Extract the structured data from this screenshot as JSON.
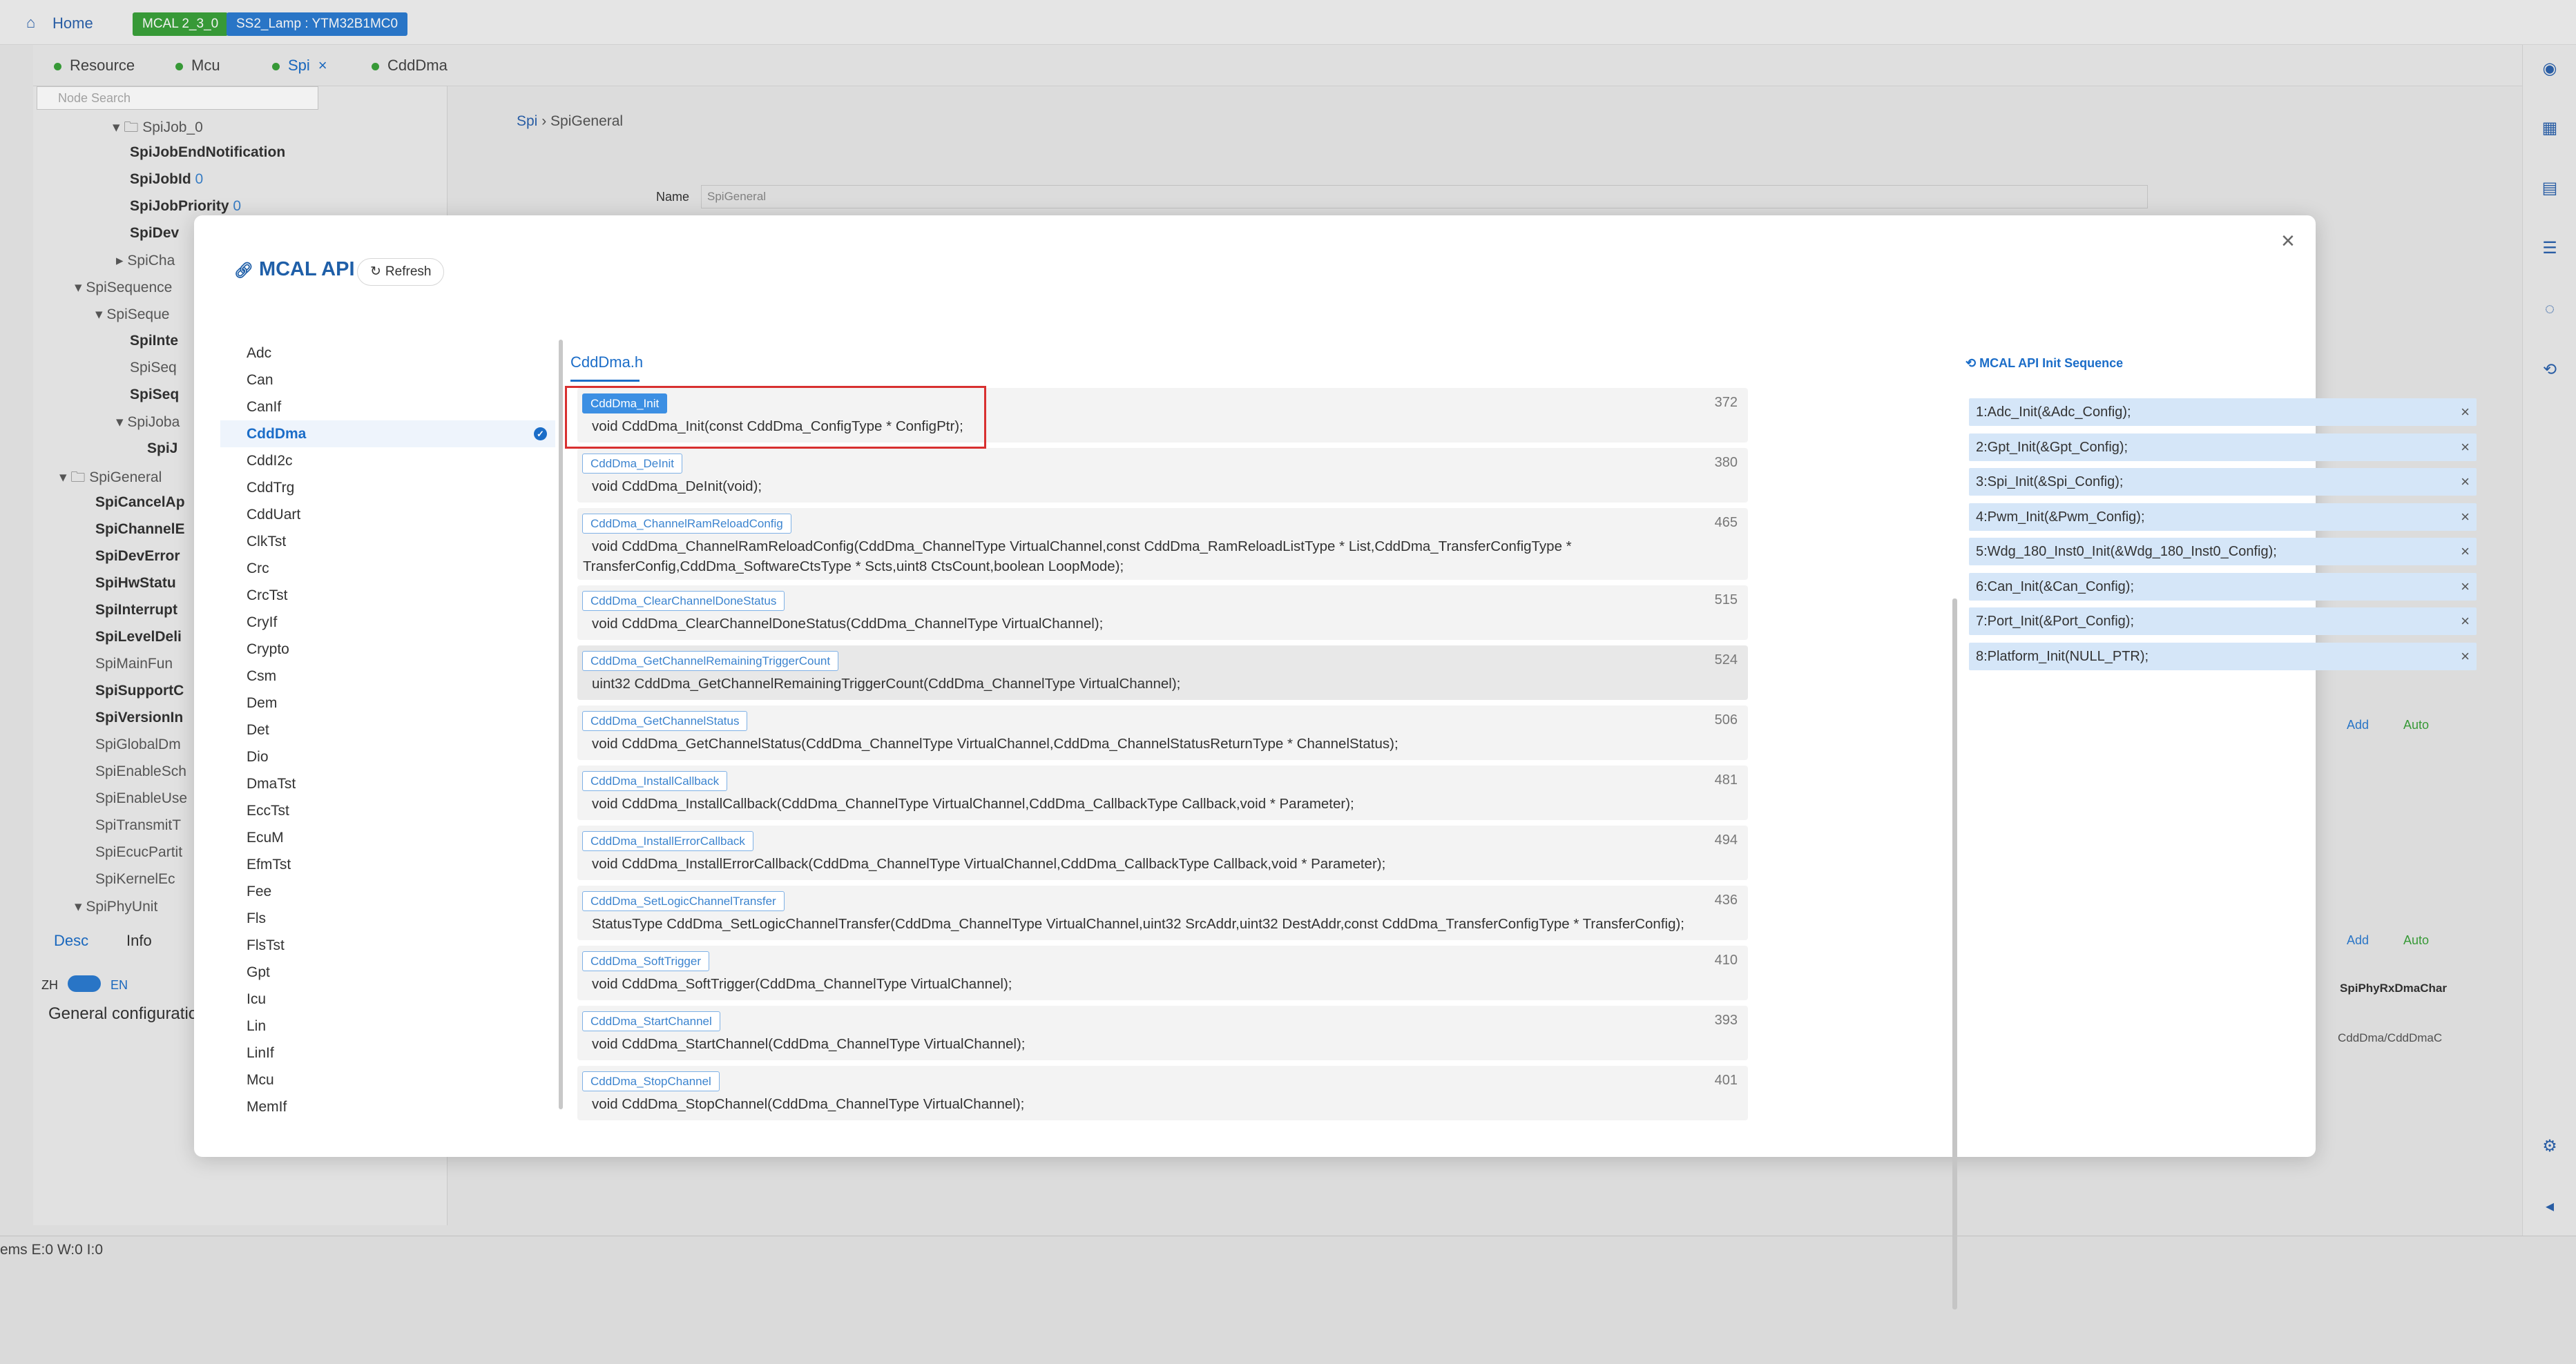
{
  "topbar": {
    "home": "Home",
    "mcal_badge": "MCAL 2_3_0",
    "project_badge": "SS2_Lamp : YTM32B1MC0"
  },
  "tabs": [
    {
      "label": "Resource",
      "closable": false
    },
    {
      "label": "Mcu",
      "closable": false
    },
    {
      "label": "Spi",
      "closable": true
    },
    {
      "label": "CddDma",
      "closable": false
    }
  ],
  "left_panel": {
    "search_placeholder": "Node Search",
    "tree": [
      "SpiJob_0",
      "SpiJobEndNotification",
      "SpiJobId",
      "0",
      "SpiJobPriority",
      "0",
      "SpiDev",
      "SpiCha",
      "SpiSequence",
      "SpiSeque",
      "SpiInte",
      "SpiSeq",
      "SpiSeq",
      "SpiJoba",
      "SpiJ",
      "SpiGeneral",
      "SpiCancelAp",
      "SpiChannelE",
      "SpiDevError",
      "SpiHwStatu",
      "SpiInterrupt",
      "SpiLevelDeli",
      "SpiMainFun",
      "SpiSupportC",
      "SpiVersionIn",
      "SpiGlobalDm",
      "SpiEnableSch",
      "SpiEnableUse",
      "SpiTransmitT",
      "SpiEcucPartit",
      "SpiKernelEc",
      "SpiPhyUnit"
    ],
    "desc_tab": "Desc",
    "info_tab": "Info",
    "lang_zh": "ZH",
    "lang_en": "EN",
    "desc_text": "General configuratio"
  },
  "background": {
    "breadcrumb_root": "Spi",
    "breadcrumb_leaf": "SpiGeneral",
    "name_label": "Name",
    "name_value": "SpiGeneral",
    "add": "Add",
    "auto": "Auto",
    "col_header": "SpiPhyRxDmaChar",
    "cell": "CddDma/CddDmaC"
  },
  "status": {
    "problems": "ems  E:0  W:0  I:0"
  },
  "modal": {
    "title": "MCAL API",
    "refresh": "Refresh",
    "close": "×",
    "modules": [
      "Adc",
      "Can",
      "CanIf",
      "CddDma",
      "CddI2c",
      "CddTrg",
      "CddUart",
      "ClkTst",
      "Crc",
      "CrcTst",
      "CryIf",
      "Crypto",
      "Csm",
      "Dem",
      "Det",
      "Dio",
      "DmaTst",
      "EccTst",
      "EcuM",
      "EfmTst",
      "Fee",
      "Fls",
      "FlsTst",
      "Gpt",
      "Icu",
      "Lin",
      "LinIf",
      "Mcu",
      "MemIf"
    ],
    "selected_module": "CddDma",
    "file_tab": "CddDma.h",
    "apis": [
      {
        "name": "CddDma_Init",
        "line": "372",
        "sig": [
          "void CddDma_Init(const CddDma_ConfigType * ConfigPtr);"
        ]
      },
      {
        "name": "CddDma_DeInit",
        "line": "380",
        "sig": [
          "void CddDma_DeInit(void);"
        ]
      },
      {
        "name": "CddDma_ChannelRamReloadConfig",
        "line": "465",
        "sig": [
          "void CddDma_ChannelRamReloadConfig(CddDma_ChannelType VirtualChannel,const CddDma_RamReloadListType * List,CddDma_TransferConfigType *",
          "TransferConfig,CddDma_SoftwareCtsType * Scts,uint8 CtsCount,boolean LoopMode);"
        ]
      },
      {
        "name": "CddDma_ClearChannelDoneStatus",
        "line": "515",
        "sig": [
          "void CddDma_ClearChannelDoneStatus(CddDma_ChannelType VirtualChannel);"
        ]
      },
      {
        "name": "CddDma_GetChannelRemainingTriggerCount",
        "line": "524",
        "sig": [
          "uint32 CddDma_GetChannelRemainingTriggerCount(CddDma_ChannelType VirtualChannel);"
        ]
      },
      {
        "name": "CddDma_GetChannelStatus",
        "line": "506",
        "sig": [
          "void CddDma_GetChannelStatus(CddDma_ChannelType VirtualChannel,CddDma_ChannelStatusReturnType * ChannelStatus);"
        ]
      },
      {
        "name": "CddDma_InstallCallback",
        "line": "481",
        "sig": [
          "void CddDma_InstallCallback(CddDma_ChannelType VirtualChannel,CddDma_CallbackType Callback,void * Parameter);"
        ]
      },
      {
        "name": "CddDma_InstallErrorCallback",
        "line": "494",
        "sig": [
          "void CddDma_InstallErrorCallback(CddDma_ChannelType VirtualChannel,CddDma_CallbackType Callback,void * Parameter);"
        ]
      },
      {
        "name": "CddDma_SetLogicChannelTransfer",
        "line": "436",
        "sig": [
          "StatusType CddDma_SetLogicChannelTransfer(CddDma_ChannelType VirtualChannel,uint32 SrcAddr,uint32 DestAddr,const CddDma_TransferConfigType * TransferConfig);"
        ]
      },
      {
        "name": "CddDma_SoftTrigger",
        "line": "410",
        "sig": [
          "void CddDma_SoftTrigger(CddDma_ChannelType VirtualChannel);"
        ]
      },
      {
        "name": "CddDma_StartChannel",
        "line": "393",
        "sig": [
          "void CddDma_StartChannel(CddDma_ChannelType VirtualChannel);"
        ]
      },
      {
        "name": "CddDma_StopChannel",
        "line": "401",
        "sig": [
          "void CddDma_StopChannel(CddDma_ChannelType VirtualChannel);"
        ]
      }
    ],
    "init_sequence_title": "MCAL API Init Sequence",
    "init_sequence": [
      "1:Adc_Init(&Adc_Config);",
      "2:Gpt_Init(&Gpt_Config);",
      "3:Spi_Init(&Spi_Config);",
      "4:Pwm_Init(&Pwm_Config);",
      "5:Wdg_180_Inst0_Init(&Wdg_180_Inst0_Config);",
      "6:Can_Init(&Can_Config);",
      "7:Port_Init(&Port_Config);",
      "8:Platform_Init(NULL_PTR);"
    ]
  },
  "colors": {
    "accent": "#1b6dc8",
    "highlight_box": "#d83030",
    "seq_bg": "#d5e6f8"
  }
}
